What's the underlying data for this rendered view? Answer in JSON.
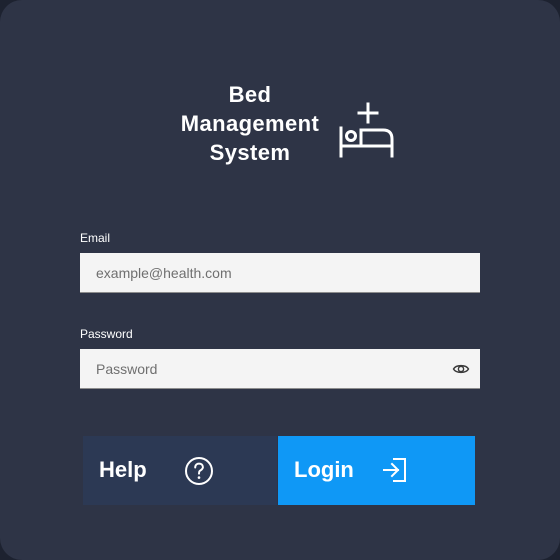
{
  "brand": {
    "title_lines": [
      "Bed",
      "Management",
      "System"
    ],
    "icon": "bed-plus-icon"
  },
  "form": {
    "email": {
      "label": "Email",
      "placeholder": "example@health.com",
      "value": ""
    },
    "password": {
      "label": "Password",
      "placeholder": "Password",
      "value": "",
      "toggle_icon": "eye-icon"
    }
  },
  "buttons": {
    "help": {
      "label": "Help",
      "icon": "help-circle-icon"
    },
    "login": {
      "label": "Login",
      "icon": "login-arrow-icon"
    }
  },
  "colors": {
    "card_background": "#2e3446",
    "input_background": "#f4f4f4",
    "help_button": "#2c3954",
    "login_button": "#0f98f6",
    "text": "#ffffff"
  }
}
